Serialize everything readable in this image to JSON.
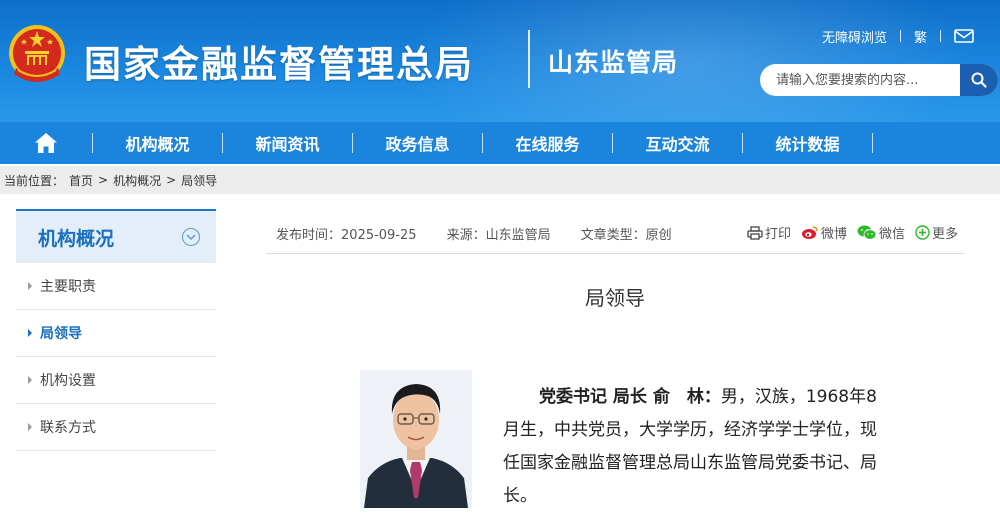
{
  "header": {
    "site_title": "国家金融监督管理总局",
    "sub_title": "山东监管局",
    "links": {
      "accessible": "无障碍浏览",
      "traditional": "繁"
    },
    "search": {
      "placeholder": "请输入您要搜索的内容..."
    },
    "icons": [
      "national-emblem",
      "mail-icon",
      "search-icon"
    ]
  },
  "nav": {
    "items": [
      "机构概况",
      "新闻资讯",
      "政务信息",
      "在线服务",
      "互动交流",
      "统计数据"
    ],
    "home_icon": "home-icon"
  },
  "breadcrumb": {
    "prefix": "当前位置：",
    "items": [
      "首页",
      "机构概况",
      "局领导"
    ],
    "separator": ">"
  },
  "sidebar": {
    "heading": "机构概况",
    "items": [
      {
        "label": "主要职责",
        "active": false
      },
      {
        "label": "局领导",
        "active": true
      },
      {
        "label": "机构设置",
        "active": false
      },
      {
        "label": "联系方式",
        "active": false
      }
    ]
  },
  "article": {
    "publish_time": "发布时间：2025-09-25",
    "source": "来源：山东监管局",
    "type": "文章类型：原创",
    "share": {
      "print": "打印",
      "weibo": "微博",
      "wechat": "微信",
      "more": "更多"
    },
    "title": "局领导",
    "leader": {
      "role": "党委书记 局长 俞　林：",
      "bio": "男，汉族，1968年8月生，中共党员，大学学历，经济学学士学位，现任国家金融监督管理总局山东监管局党委书记、局长。"
    }
  },
  "colors": {
    "banner": "#1a86df",
    "nav": "#1b84dd",
    "accent": "#1a6fc0",
    "breadcrumb_bg": "#ececec"
  }
}
